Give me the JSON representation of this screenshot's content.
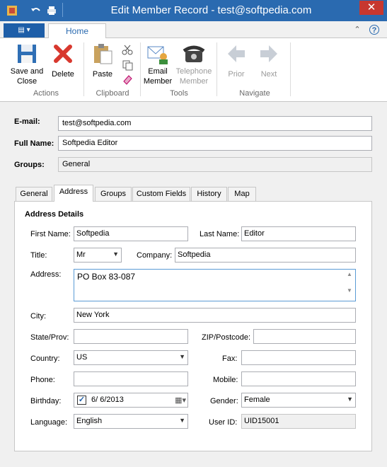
{
  "window": {
    "title": "Edit Member Record - test@softpedia.com",
    "close_glyph": "✕"
  },
  "ribbon": {
    "file_menu_glyph": "▤ ▾",
    "tab": "Home",
    "groups": {
      "actions": {
        "label": "Actions",
        "save_close_line1": "Save and",
        "save_close_line2": "Close",
        "delete": "Delete"
      },
      "clipboard": {
        "label": "Clipboard",
        "paste": "Paste"
      },
      "tools": {
        "label": "Tools",
        "email_line1": "Email",
        "email_line2": "Member",
        "telephone_line1": "Telephone",
        "telephone_line2": "Member"
      },
      "navigate": {
        "label": "Navigate",
        "prior": "Prior",
        "next": "Next"
      }
    },
    "collapse_glyph": "⌃",
    "help_glyph": "?"
  },
  "member": {
    "email_label": "E-mail:",
    "email": "test@softpedia.com",
    "fullname_label": "Full Name:",
    "fullname": "Softpedia Editor",
    "groups_label": "Groups:",
    "groups": "General"
  },
  "tabs": [
    "General",
    "Address",
    "Groups",
    "Custom Fields",
    "History",
    "Map"
  ],
  "address": {
    "heading": "Address Details",
    "first_name_label": "First Name:",
    "first_name": "Softpedia",
    "last_name_label": "Last Name:",
    "last_name": "Editor",
    "title_label": "Title:",
    "title": "Mr",
    "company_label": "Company:",
    "company": "Softpedia",
    "address_label": "Address:",
    "address": "PO Box 83-087",
    "city_label": "City:",
    "city": "New York",
    "state_label": "State/Prov:",
    "state": "",
    "zip_label": "ZIP/Postcode:",
    "zip": "",
    "country_label": "Country:",
    "country": "US",
    "fax_label": "Fax:",
    "fax": "",
    "phone_label": "Phone:",
    "phone": "",
    "mobile_label": "Mobile:",
    "mobile": "",
    "birthday_label": "Birthday:",
    "birthday": "6/  6/2013",
    "birthday_checked": true,
    "gender_label": "Gender:",
    "gender": "Female",
    "language_label": "Language:",
    "language": "English",
    "userid_label": "User ID:",
    "userid": "UID15001"
  },
  "colors": {
    "titlebar": "#2a6ab0",
    "accent": "#1e5ea8",
    "close": "#c7372f"
  }
}
